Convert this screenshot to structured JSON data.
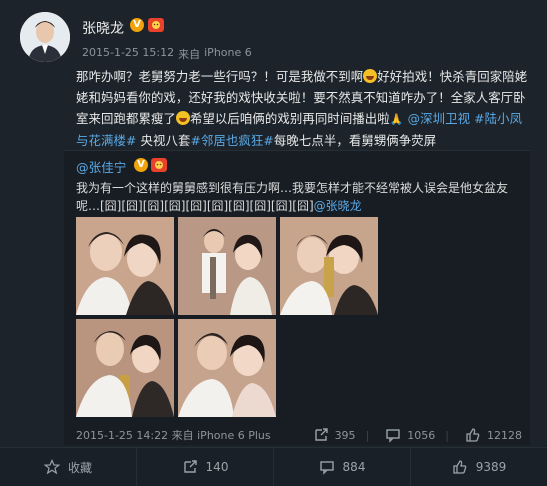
{
  "post": {
    "username": "张晓龙",
    "meta_time": "2015-1-25 15:12",
    "meta_source_prefix": "来自",
    "meta_source": "iPhone 6",
    "text": {
      "p1": "那咋办啊？老舅努力老一些行吗？！可是我做不到啊",
      "p2": "好好拍戏！快杀青回家陪姥姥和妈妈看你的戏，还好我的戏快收关啦！要不然真不知道咋办了！全家人客厅卧室来回跑都累瘦了",
      "p3": "希望以后咱俩的戏别再同时间播出啦",
      "tag1": "@深圳卫视",
      "tag2": "#陆小凤与花满楼#",
      "p4": " 央视八套",
      "tag3": "#邻居也疯狂#",
      "p5": "每晚七点半，看舅甥俩争荧屏"
    }
  },
  "repost": {
    "username": "@张佳宁",
    "text": "我为有一个这样的舅舅感到很有压力啊…我要怎样才能不经常被人误会是他女盆友呢…[囧][囧][囧][囧][囧][囧][囧][囧][囧][囧]",
    "mention": "@张晓龙",
    "time": "2015-1-25 14:22",
    "source_prefix": "来自",
    "source": "iPhone 6 Plus",
    "shares": "395",
    "comments": "1056",
    "likes": "12128"
  },
  "actions": {
    "favorite": "收藏",
    "repost": "140",
    "comment": "884",
    "like": "9389"
  },
  "colors": {
    "link": "#5aa9e6",
    "background": "#1c232a"
  }
}
